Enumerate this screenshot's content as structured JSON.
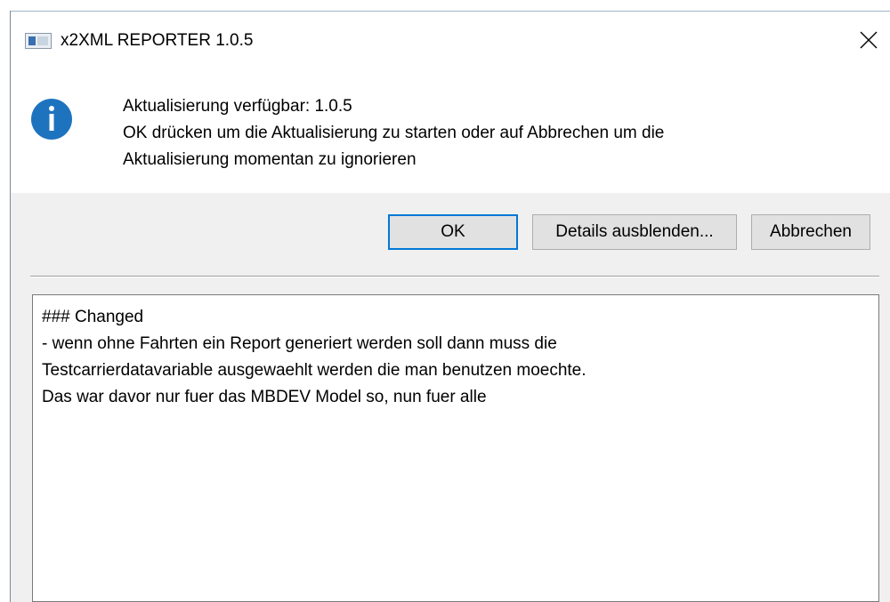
{
  "window": {
    "title": "x2XML REPORTER 1.0.5",
    "icon": "app-window-icon",
    "close_icon": "close-icon"
  },
  "message": {
    "icon": "info-icon",
    "icon_color": "#1e73be",
    "lines": [
      "Aktualisierung verfügbar: 1.0.5",
      "OK drücken um die Aktualisierung zu starten oder auf Abbrechen um die",
      "Aktualisierung momentan zu ignorieren"
    ]
  },
  "buttons": {
    "ok": "OK",
    "details": "Details ausblenden...",
    "cancel": "Abbrechen",
    "focus_color": "#0078d7"
  },
  "details": {
    "lines": [
      "### Changed",
      "- wenn ohne Fahrten ein Report generiert werden soll dann muss die",
      "Testcarrierdatavariable ausgewaehlt werden die man benutzen moechte.",
      "Das war davor nur fuer das MBDEV Model so, nun fuer alle"
    ]
  }
}
